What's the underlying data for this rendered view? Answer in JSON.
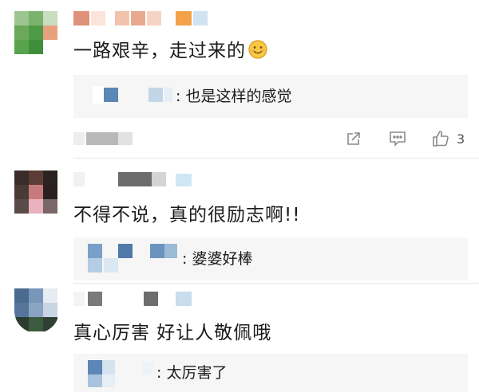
{
  "comments": [
    {
      "text": "一路艰辛，走过来的",
      "emoji": "smiling-face-emoji",
      "reply": {
        "text": ": 也是这样的感觉"
      },
      "actions": {
        "share_icon": "share-icon",
        "comment_icon": "comment-icon",
        "like_icon": "thumbs-up-icon",
        "like_count": "3"
      }
    },
    {
      "text": "不得不说，真的很励志啊!!",
      "reply": {
        "text": ": 婆婆好棒"
      }
    },
    {
      "text": "真心厉害  好让人敬佩哦",
      "reply": {
        "text": ": 太厉害了"
      }
    }
  ],
  "colors": {
    "reply_bg": "#f6f6f6",
    "divider": "#e6e6e6",
    "icon_gray": "#8a8a8a"
  }
}
